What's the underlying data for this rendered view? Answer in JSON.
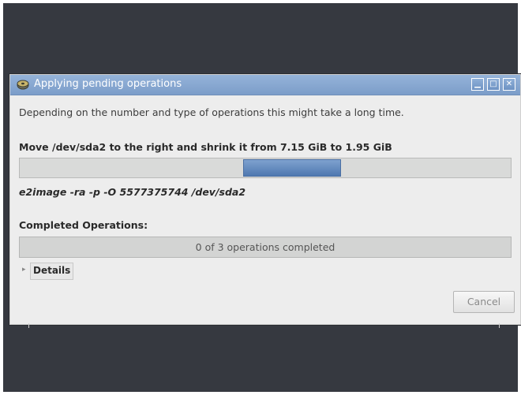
{
  "dialog": {
    "title": "Applying pending operations",
    "info_text": "Depending on the number and type of operations this might take a long time.",
    "current_operation": "Move /dev/sda2 to the right and shrink it from 7.15 GiB to 1.95 GiB",
    "current_progress": {
      "start": 0.455,
      "end": 0.655
    },
    "command": "e2image -ra -p -O 5577375744 /dev/sda2",
    "completed_label": "Completed Operations:",
    "completed_status": "0 of 3 operations completed",
    "details_expander": "▸",
    "details_label": "Details",
    "cancel_label": "Cancel",
    "window_buttons": {
      "minimize": "▁",
      "maximize": "□",
      "close": "✕"
    },
    "icons": {
      "app": "gparted-icon"
    },
    "colors": {
      "titlebar": "#7c9dc9",
      "progress_fill": "#5b84ba",
      "background": "#ededed"
    }
  }
}
